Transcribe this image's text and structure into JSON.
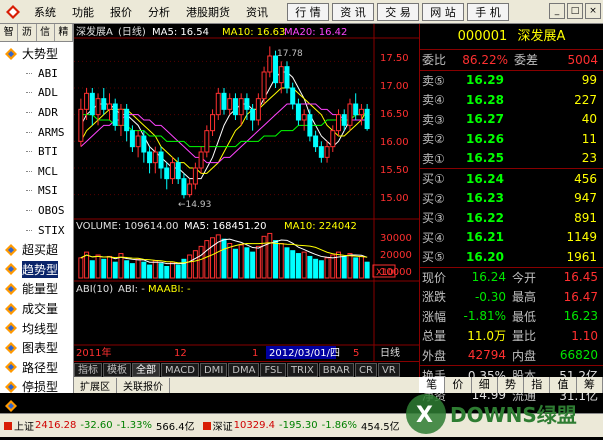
{
  "menubar": {
    "items": [
      "系统",
      "功能",
      "报价",
      "分析",
      "港股期货",
      "资讯"
    ],
    "nav": [
      "行 情",
      "资 讯",
      "交 易",
      "网 站",
      "手 机"
    ],
    "win": [
      "_",
      "□",
      "×"
    ]
  },
  "sidebar": {
    "tabs": [
      "智",
      "沥",
      "信",
      "精"
    ],
    "tree": [
      {
        "label": "大势型",
        "child": false,
        "selected": false
      },
      {
        "label": "ABI",
        "child": true,
        "selected": false
      },
      {
        "label": "ADL",
        "child": true,
        "selected": false
      },
      {
        "label": "ADR",
        "child": true,
        "selected": false
      },
      {
        "label": "ARMS",
        "child": true,
        "selected": false
      },
      {
        "label": "BTI",
        "child": true,
        "selected": false
      },
      {
        "label": "MCL",
        "child": true,
        "selected": false
      },
      {
        "label": "MSI",
        "child": true,
        "selected": false
      },
      {
        "label": "OBOS",
        "child": true,
        "selected": false
      },
      {
        "label": "STIX",
        "child": true,
        "selected": false
      },
      {
        "label": "超买超",
        "child": false,
        "selected": false
      },
      {
        "label": "趋势型",
        "child": false,
        "selected": true
      },
      {
        "label": "能量型",
        "child": false,
        "selected": false
      },
      {
        "label": "成交量",
        "child": false,
        "selected": false
      },
      {
        "label": "均线型",
        "child": false,
        "selected": false
      },
      {
        "label": "图表型",
        "child": false,
        "selected": false
      },
      {
        "label": "路径型",
        "child": false,
        "selected": false
      },
      {
        "label": "停损型",
        "child": false,
        "selected": false
      },
      {
        "label": "交易型",
        "child": false,
        "selected": false
      }
    ]
  },
  "chart": {
    "header_name": "深发展A",
    "period": "(日线)",
    "ma5": "MA5: 16.54",
    "ma10": "MA10: 16.63",
    "ma20": "MA20: 16.42",
    "high_mark": "17.78",
    "low_mark": "←14.93",
    "price_ticks": [
      "17.50",
      "17.00",
      "16.50",
      "16.00",
      "15.50",
      "15.00"
    ],
    "volume_header": "VOLUME: 109614.00",
    "vol_ma5": "MA5: 168451.20",
    "vol_ma10": "MA10: 224042",
    "vol_ticks": [
      "30000",
      "20000",
      "10000"
    ],
    "vol_unit": "X10",
    "abi_header": "ABI(10)",
    "abi_value": "ABI: -",
    "maabi": "MAABI: -",
    "date_left": "2011年",
    "date_mark": "12",
    "date_mid": "1",
    "date_box": "2012/03/01/四",
    "date_right": "5",
    "period_label": "日线"
  },
  "chart_data": {
    "type": "candlestick",
    "ylim": [
      14.6,
      17.9
    ],
    "candles": [
      {
        "o": 16.0,
        "c": 16.6,
        "h": 16.8,
        "l": 15.9
      },
      {
        "o": 16.6,
        "c": 16.9,
        "h": 17.0,
        "l": 16.4
      },
      {
        "o": 16.9,
        "c": 16.5,
        "h": 17.0,
        "l": 16.3
      },
      {
        "o": 16.5,
        "c": 16.8,
        "h": 16.9,
        "l": 16.3
      },
      {
        "o": 16.8,
        "c": 16.6,
        "h": 17.0,
        "l": 16.5
      },
      {
        "o": 16.6,
        "c": 16.7,
        "h": 16.9,
        "l": 16.4
      },
      {
        "o": 16.7,
        "c": 16.3,
        "h": 16.8,
        "l": 16.2
      },
      {
        "o": 16.3,
        "c": 16.6,
        "h": 16.7,
        "l": 16.1
      },
      {
        "o": 16.6,
        "c": 16.2,
        "h": 16.7,
        "l": 16.0
      },
      {
        "o": 16.2,
        "c": 15.9,
        "h": 16.3,
        "l": 15.8
      },
      {
        "o": 15.9,
        "c": 16.1,
        "h": 16.2,
        "l": 15.7
      },
      {
        "o": 16.1,
        "c": 15.8,
        "h": 16.2,
        "l": 15.6
      },
      {
        "o": 15.8,
        "c": 15.6,
        "h": 15.9,
        "l": 15.4
      },
      {
        "o": 15.6,
        "c": 15.8,
        "h": 15.9,
        "l": 15.4
      },
      {
        "o": 15.8,
        "c": 15.5,
        "h": 15.9,
        "l": 15.3
      },
      {
        "o": 15.5,
        "c": 15.3,
        "h": 15.6,
        "l": 15.1
      },
      {
        "o": 15.3,
        "c": 15.6,
        "h": 15.7,
        "l": 15.2
      },
      {
        "o": 15.6,
        "c": 15.3,
        "h": 15.7,
        "l": 15.2
      },
      {
        "o": 15.3,
        "c": 15.0,
        "h": 15.4,
        "l": 14.93
      },
      {
        "o": 15.0,
        "c": 15.2,
        "h": 15.3,
        "l": 14.95
      },
      {
        "o": 15.2,
        "c": 15.5,
        "h": 15.6,
        "l": 15.1
      },
      {
        "o": 15.5,
        "c": 15.8,
        "h": 15.9,
        "l": 15.4
      },
      {
        "o": 15.8,
        "c": 16.2,
        "h": 16.3,
        "l": 15.7
      },
      {
        "o": 16.2,
        "c": 16.5,
        "h": 16.6,
        "l": 16.1
      },
      {
        "o": 16.5,
        "c": 16.9,
        "h": 17.0,
        "l": 16.4
      },
      {
        "o": 16.9,
        "c": 16.6,
        "h": 17.0,
        "l": 16.5
      },
      {
        "o": 16.6,
        "c": 16.8,
        "h": 16.9,
        "l": 16.5
      },
      {
        "o": 16.8,
        "c": 16.5,
        "h": 16.9,
        "l": 16.4
      },
      {
        "o": 16.5,
        "c": 16.8,
        "h": 16.9,
        "l": 16.3
      },
      {
        "o": 16.8,
        "c": 16.6,
        "h": 16.9,
        "l": 16.4
      },
      {
        "o": 16.6,
        "c": 16.4,
        "h": 16.7,
        "l": 16.2
      },
      {
        "o": 16.4,
        "c": 16.8,
        "h": 16.9,
        "l": 16.3
      },
      {
        "o": 16.8,
        "c": 17.3,
        "h": 17.4,
        "l": 16.7
      },
      {
        "o": 17.3,
        "c": 17.6,
        "h": 17.78,
        "l": 17.2
      },
      {
        "o": 17.6,
        "c": 17.1,
        "h": 17.7,
        "l": 17.0
      },
      {
        "o": 17.1,
        "c": 17.4,
        "h": 17.5,
        "l": 16.9
      },
      {
        "o": 17.4,
        "c": 17.0,
        "h": 17.5,
        "l": 16.9
      },
      {
        "o": 17.0,
        "c": 16.7,
        "h": 17.1,
        "l": 16.6
      },
      {
        "o": 16.7,
        "c": 16.4,
        "h": 16.8,
        "l": 16.3
      },
      {
        "o": 16.4,
        "c": 16.5,
        "h": 16.6,
        "l": 16.2
      },
      {
        "o": 16.5,
        "c": 16.1,
        "h": 16.6,
        "l": 16.0
      },
      {
        "o": 16.1,
        "c": 15.9,
        "h": 16.2,
        "l": 15.8
      },
      {
        "o": 15.9,
        "c": 15.7,
        "h": 16.0,
        "l": 15.6
      },
      {
        "o": 15.7,
        "c": 15.9,
        "h": 16.0,
        "l": 15.6
      },
      {
        "o": 15.9,
        "c": 16.2,
        "h": 16.3,
        "l": 15.8
      },
      {
        "o": 16.2,
        "c": 16.5,
        "h": 16.6,
        "l": 16.1
      },
      {
        "o": 16.5,
        "c": 16.3,
        "h": 16.6,
        "l": 16.2
      },
      {
        "o": 16.3,
        "c": 16.7,
        "h": 16.8,
        "l": 16.2
      },
      {
        "o": 16.7,
        "c": 16.5,
        "h": 16.9,
        "l": 16.4
      },
      {
        "o": 16.5,
        "c": 16.6,
        "h": 16.7,
        "l": 16.3
      },
      {
        "o": 16.6,
        "c": 16.24,
        "h": 16.7,
        "l": 16.2
      }
    ],
    "ma_series": [
      {
        "name": "MA5",
        "color": "#ffffff",
        "values": [
          16.3,
          16.5,
          16.6,
          16.7,
          16.7,
          16.7,
          16.6,
          16.5,
          16.5,
          16.4,
          16.3,
          16.1,
          15.9,
          15.8,
          15.7,
          15.6,
          15.5,
          15.5,
          15.4,
          15.3,
          15.3,
          15.3,
          15.5,
          15.7,
          16.0,
          16.3,
          16.5,
          16.6,
          16.7,
          16.7,
          16.6,
          16.6,
          16.8,
          17.0,
          17.2,
          17.3,
          17.3,
          17.2,
          17.0,
          16.8,
          16.5,
          16.3,
          16.1,
          16.0,
          15.9,
          16.0,
          16.2,
          16.4,
          16.5,
          16.5,
          16.5
        ]
      },
      {
        "name": "MA10",
        "color": "#ffff00",
        "values": [
          16.0,
          16.2,
          16.3,
          16.4,
          16.5,
          16.6,
          16.6,
          16.6,
          16.6,
          16.5,
          16.4,
          16.3,
          16.2,
          16.1,
          15.9,
          15.8,
          15.7,
          15.6,
          15.6,
          15.5,
          15.5,
          15.4,
          15.4,
          15.5,
          15.6,
          15.8,
          16.0,
          16.2,
          16.3,
          16.5,
          16.6,
          16.6,
          16.7,
          16.8,
          16.9,
          17.0,
          17.0,
          17.0,
          16.9,
          16.8,
          16.7,
          16.6,
          16.5,
          16.3,
          16.2,
          16.1,
          16.1,
          16.2,
          16.3,
          16.4,
          16.6
        ]
      },
      {
        "name": "MA20",
        "color": "#ff44ff",
        "values": [
          15.9,
          16.0,
          16.1,
          16.2,
          16.3,
          16.3,
          16.4,
          16.4,
          16.5,
          16.5,
          16.5,
          16.4,
          16.4,
          16.3,
          16.3,
          16.2,
          16.1,
          16.0,
          15.9,
          15.8,
          15.7,
          15.7,
          15.6,
          15.6,
          15.6,
          15.7,
          15.7,
          15.8,
          15.9,
          16.0,
          16.1,
          16.2,
          16.3,
          16.4,
          16.5,
          16.6,
          16.7,
          16.7,
          16.7,
          16.7,
          16.7,
          16.7,
          16.6,
          16.6,
          16.5,
          16.5,
          16.4,
          16.4,
          16.4,
          16.4,
          16.4
        ]
      },
      {
        "name": "MA60",
        "color": "#00ff00",
        "values": [
          16.5,
          16.5,
          16.5,
          16.4,
          16.4,
          16.4,
          16.3,
          16.3,
          16.3,
          16.2,
          16.2,
          16.2,
          16.1,
          16.1,
          16.1,
          16.0,
          16.0,
          16.0,
          16.0,
          15.9,
          15.9,
          15.9,
          15.9,
          15.9,
          15.9,
          15.9,
          15.9,
          15.9,
          16.0,
          16.0,
          16.0,
          16.0,
          16.1,
          16.1,
          16.1,
          16.2,
          16.2,
          16.2,
          16.3,
          16.3,
          16.3,
          16.3,
          16.3,
          16.4,
          16.4,
          16.4,
          16.4,
          16.4,
          16.5,
          16.5,
          16.5
        ]
      }
    ],
    "volume": [
      14,
      18,
      12,
      16,
      13,
      15,
      11,
      17,
      12,
      10,
      13,
      11,
      9,
      12,
      10,
      8,
      11,
      9,
      13,
      16,
      19,
      22,
      26,
      28,
      30,
      27,
      24,
      20,
      23,
      21,
      18,
      22,
      29,
      31,
      26,
      24,
      21,
      19,
      17,
      18,
      15,
      13,
      12,
      14,
      16,
      18,
      15,
      17,
      14,
      15,
      11
    ],
    "vol_max": 32
  },
  "quote": {
    "code": "000001",
    "name": "深发展A",
    "weibi_label": "委比",
    "weibi": "86.22%",
    "weicha_label": "委差",
    "weicha": "5004",
    "sells": [
      {
        "label": "卖⑤",
        "price": "16.29",
        "vol": "99"
      },
      {
        "label": "卖④",
        "price": "16.28",
        "vol": "227"
      },
      {
        "label": "卖③",
        "price": "16.27",
        "vol": "40"
      },
      {
        "label": "卖②",
        "price": "16.26",
        "vol": "11"
      },
      {
        "label": "卖①",
        "price": "16.25",
        "vol": "23"
      }
    ],
    "buys": [
      {
        "label": "买①",
        "price": "16.24",
        "vol": "456"
      },
      {
        "label": "买②",
        "price": "16.23",
        "vol": "947"
      },
      {
        "label": "买③",
        "price": "16.22",
        "vol": "891"
      },
      {
        "label": "买④",
        "price": "16.21",
        "vol": "1149"
      },
      {
        "label": "买⑤",
        "price": "16.20",
        "vol": "1961"
      }
    ],
    "fields": [
      {
        "l1": "现价",
        "v1": "16.24",
        "c1": "green",
        "l2": "今开",
        "v2": "16.45",
        "c2": "red"
      },
      {
        "l1": "涨跌",
        "v1": "-0.30",
        "c1": "green",
        "l2": "最高",
        "v2": "16.47",
        "c2": "red"
      },
      {
        "l1": "涨幅",
        "v1": "-1.81%",
        "c1": "green",
        "l2": "最低",
        "v2": "16.23",
        "c2": "green"
      },
      {
        "l1": "总量",
        "v1": "11.0万",
        "c1": "yellow",
        "l2": "量比",
        "v2": "1.10",
        "c2": "red"
      },
      {
        "l1": "外盘",
        "v1": "42794",
        "c1": "red",
        "l2": "内盘",
        "v2": "66820",
        "c2": "green"
      }
    ],
    "fields2": [
      {
        "l1": "换手",
        "v1": "0.35%",
        "c1": "white",
        "l2": "股本",
        "v2": "51.2亿",
        "c2": "white"
      },
      {
        "l1": "净资",
        "v1": "14.99",
        "c1": "white",
        "l2": "流通",
        "v2": "31.1亿",
        "c2": "white"
      }
    ],
    "tabs": [
      "笔",
      "价",
      "细",
      "势",
      "指",
      "值",
      "筹"
    ]
  },
  "bottom_tabs": [
    "指标",
    "模板",
    "全部",
    "MACD",
    "DMI",
    "DMA",
    "FSL",
    "TRIX",
    "BRAR",
    "CR",
    "VR"
  ],
  "ext_tabs": [
    "扩展区",
    "关联报价"
  ],
  "status": [
    {
      "label": "上证",
      "text": "2416.28",
      "cls": "red"
    },
    {
      "label": "",
      "text": "-32.60",
      "cls": "green"
    },
    {
      "label": "",
      "text": "-1.33%",
      "cls": "green"
    },
    {
      "label": "",
      "text": "566.4亿",
      "cls": ""
    },
    {
      "label": "深证",
      "text": "10329.4",
      "cls": "red"
    },
    {
      "label": "",
      "text": "-195.30",
      "cls": "green"
    },
    {
      "label": "",
      "text": "-1.86%",
      "cls": "green"
    },
    {
      "label": "",
      "text": "454.5亿",
      "cls": ""
    }
  ],
  "watermark": "DOWNS绿盟"
}
